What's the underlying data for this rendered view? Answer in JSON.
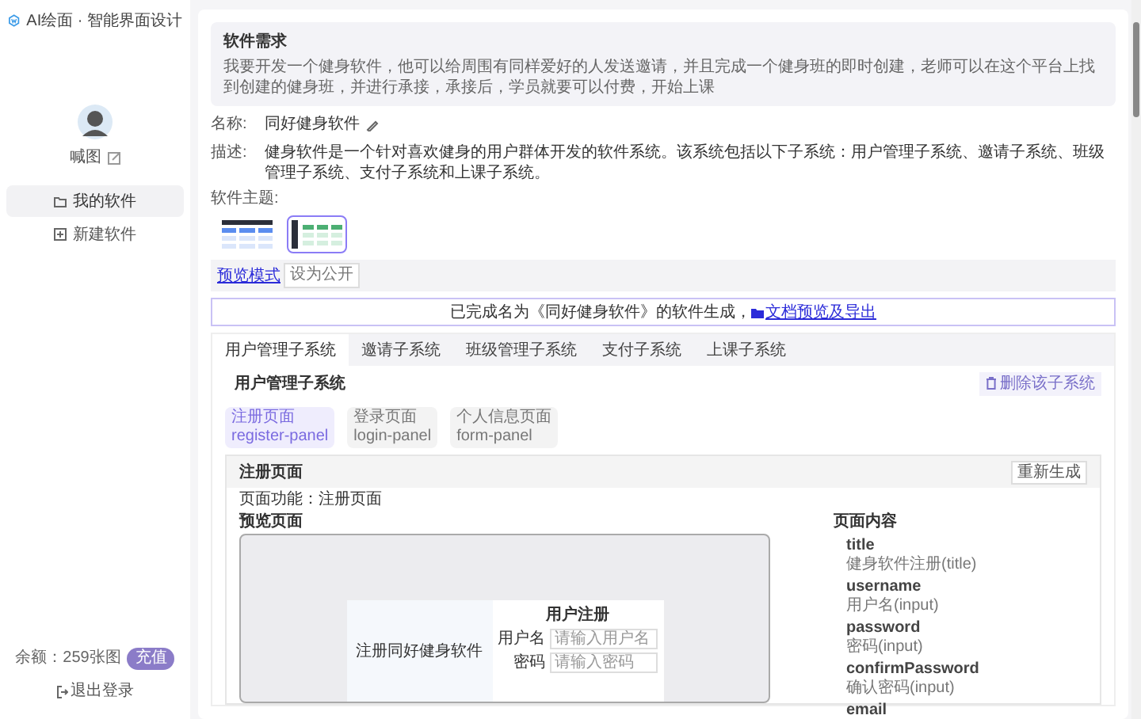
{
  "app": {
    "logo_text": "AI绘面 · 智能界面设计"
  },
  "sidebar": {
    "user_name": "喊图",
    "items": [
      {
        "label": "我的软件",
        "kind": "folder",
        "selected": true
      },
      {
        "label": "新建软件",
        "kind": "add",
        "selected": false
      }
    ],
    "balance": "余额：259张图",
    "recharge": "充值",
    "logout": "退出登录"
  },
  "requirement": {
    "title": "软件需求",
    "text": "我要开发一个健身软件，他可以给周围有同样爱好的人发送邀请，并且完成一个健身班的即时创建，老师可以在这个平台上找到创建的健身班，并进行承接，承接后，学员就要可以付费，开始上课"
  },
  "info": {
    "name_label": "名称:",
    "name": "同好健身软件",
    "desc_label": "描述:",
    "desc": "健身软件是一个针对喜欢健身的用户群体开发的软件系统。该系统包括以下子系统：用户管理子系统、邀请子系统、班级管理子系统、支付子系统和上课子系统。",
    "theme_label": "软件主题:",
    "themes": [
      {
        "kind": "topbar",
        "selected": false
      },
      {
        "kind": "sidebar",
        "selected": true
      }
    ]
  },
  "actions": {
    "preview_link": "预览模式",
    "public_button": "设为公开"
  },
  "banner": {
    "text": "已完成名为《同好健身软件》的软件生成，",
    "link": "文档预览及导出"
  },
  "tabs": [
    {
      "label": "用户管理子系统",
      "selected": true
    },
    {
      "label": "邀请子系统",
      "selected": false
    },
    {
      "label": "班级管理子系统",
      "selected": false
    },
    {
      "label": "支付子系统",
      "selected": false
    },
    {
      "label": "上课子系统",
      "selected": false
    }
  ],
  "subsystem": {
    "title": "用户管理子系统",
    "delete_button": "删除该子系统",
    "pages": [
      {
        "name": "注册页面",
        "id": "register-panel",
        "selected": true
      },
      {
        "name": "登录页面",
        "id": "login-panel",
        "selected": false
      },
      {
        "name": "个人信息页面",
        "id": "form-panel",
        "selected": false
      }
    ]
  },
  "page_panel": {
    "title": "注册页面",
    "regenerate": "重新生成",
    "function": "页面功能：注册页面",
    "preview_title": "预览页面",
    "content_title": "页面内容",
    "preview": {
      "hero": "注册同好健身软件",
      "form_title": "用户注册",
      "fields": [
        {
          "label": "用户名",
          "placeholder": "请输入用户名"
        },
        {
          "label": "密码",
          "placeholder": "请输入密码"
        }
      ]
    },
    "content_items": [
      {
        "name": "title",
        "desc": "健身软件注册(title)"
      },
      {
        "name": "username",
        "desc": "用户名(input)"
      },
      {
        "name": "password",
        "desc": "密码(input)"
      },
      {
        "name": "confirmPassword",
        "desc": "确认密码(input)"
      },
      {
        "name": "email"
      }
    ]
  }
}
